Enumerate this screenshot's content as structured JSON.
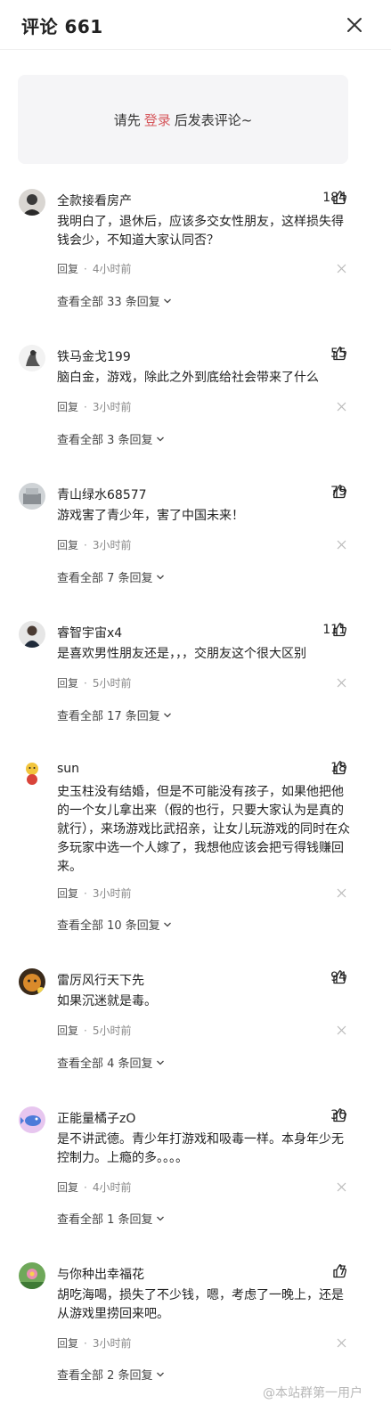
{
  "header": {
    "title": "评论 661"
  },
  "login_prompt": {
    "before": "请先",
    "link": "登录",
    "after": "后发表评论~"
  },
  "comments": [
    {
      "username": "全款接看房产",
      "likes": "184",
      "content": "我明白了，退休后，应该多交女性朋友，这样损失得钱会少，不知道大家认同否？",
      "reply_label": "回复",
      "time": "4小时前",
      "view_all": "查看全部 33 条回复"
    },
    {
      "username": "铁马金戈199",
      "likes": "55",
      "content": "脑白金，游戏，除此之外到底给社会带来了什么",
      "reply_label": "回复",
      "time": "3小时前",
      "view_all": "查看全部 3 条回复"
    },
    {
      "username": "青山绿水68577",
      "likes": "79",
      "content": "游戏害了青少年，害了中国未来！",
      "reply_label": "回复",
      "time": "3小时前",
      "view_all": "查看全部 7 条回复"
    },
    {
      "username": "睿智宇宙x4",
      "likes": "111",
      "content": "是喜欢男性朋友还是，，，交朋友这个很大区别",
      "reply_label": "回复",
      "time": "5小时前",
      "view_all": "查看全部 17 条回复"
    },
    {
      "username": "sun",
      "likes": "18",
      "content": "史玉柱没有结婚，但是不可能没有孩子，如果他把他的一个女儿拿出来（假的也行，只要大家认为是真的就行），来场游戏比武招亲，让女儿玩游戏的同时在众多玩家中选一个人嫁了，我想他应该会把亏得钱赚回来。",
      "reply_label": "回复",
      "time": "3小时前",
      "view_all": "查看全部 10 条回复"
    },
    {
      "username": "雷厉风行天下先",
      "likes": "94",
      "content": "如果沉迷就是毒。",
      "reply_label": "回复",
      "time": "5小时前",
      "view_all": "查看全部 4 条回复"
    },
    {
      "username": "正能量橘子zO",
      "likes": "30",
      "content": "是不讲武德。青少年打游戏和吸毒一样。本身年少无控制力。上瘾的多。。。。",
      "reply_label": "回复",
      "time": "4小时前",
      "view_all": "查看全部 1 条回复"
    },
    {
      "username": "与你种出幸福花",
      "likes": "7",
      "content": "胡吃海喝，损失了不少钱，嗯，考虑了一晚上，还是从游戏里捞回来吧。",
      "reply_label": "回复",
      "time": "3小时前",
      "view_all": "查看全部 2 条回复"
    }
  ],
  "watermark": "@本站群第一用户",
  "colors": {
    "accent_link": "#d6595e",
    "background": "#ffffff",
    "login_box_bg": "#f5f5f7"
  }
}
